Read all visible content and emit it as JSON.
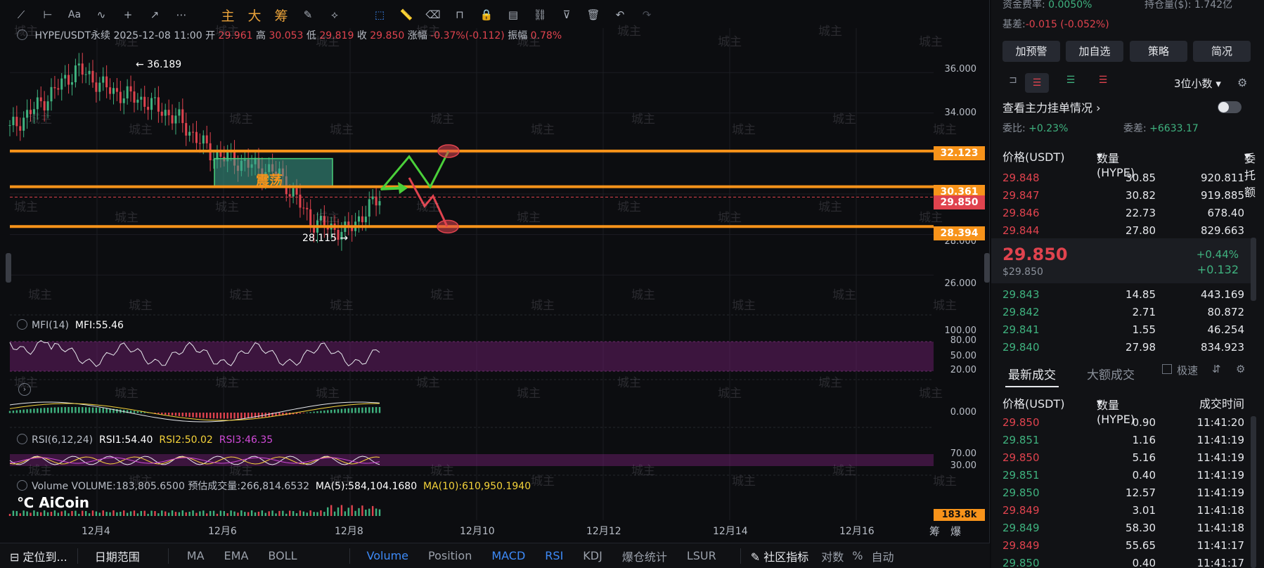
{
  "toolbar": {
    "icons": [
      "trend-line-icon",
      "horizontal-line-icon",
      "text-icon",
      "pen-icon",
      "crosshair-icon",
      "ray-icon",
      "more-icon"
    ],
    "zh_buttons": [
      "主",
      "大",
      "筹"
    ]
  },
  "info_bar": {
    "symbol": "HYPE/USDT永续",
    "datetime": "2025-12-08 11:00",
    "open_label": "开",
    "open": "29.961",
    "high_label": "高",
    "high": "30.053",
    "low_label": "低",
    "low": "29.819",
    "close_label": "收",
    "close": "29.850",
    "change_label": "涨幅",
    "change": "-0.37%(-0.112)",
    "amp_label": "振幅",
    "amp": "0.78%"
  },
  "chart_data": [
    {
      "type": "line",
      "title": "HYPE/USDT永续",
      "series": [
        {
          "name": "",
          "x": [
            "12月4",
            "12月4",
            "12月4",
            "12月5",
            "12月5",
            "12月5",
            "12月6",
            "12月6",
            "12月7",
            "12月7",
            "12月8",
            "12月8"
          ],
          "values": [
            33.2,
            34.6,
            36.19,
            35.1,
            34.6,
            33.7,
            32.0,
            31.5,
            31.0,
            28.6,
            28.12,
            29.85
          ]
        }
      ],
      "horizontal_lines": [
        32.123,
        30.361,
        28.394
      ],
      "high_label": "36.189",
      "low_label": "28.115",
      "box_label": "震荡",
      "ylim": [
        25.0,
        37.5
      ],
      "ytick_labels": [
        "36.000",
        "34.000",
        "32.000",
        "30.000",
        "28.000",
        "26.000"
      ],
      "xtick_labels": [
        "12月4",
        "12月6",
        "12月8",
        "12月10",
        "12月12",
        "12月14",
        "12月16"
      ]
    }
  ],
  "price_tags": {
    "upper": "32.123",
    "mid": "30.361",
    "current": "29.850",
    "lower": "28.394",
    "volume": "183.8k"
  },
  "annotations": {
    "high": "← 36.189",
    "low": "28.115 →",
    "box": "震荡"
  },
  "mfi": {
    "label": "MFI(14)",
    "value": "MFI:55.46",
    "ticks": [
      "100.00",
      "80.00",
      "50.00",
      "20.00"
    ]
  },
  "macd": {
    "ticks": [
      "0.000"
    ]
  },
  "rsi": {
    "label": "RSI(6,12,24)",
    "rsi1": "RSI1:54.40",
    "rsi2": "RSI2:50.02",
    "rsi3": "RSI3:46.35",
    "ticks": [
      "70.00",
      "30.00"
    ]
  },
  "volume": {
    "label": "Volume",
    "value": "VOLUME:183,805.6500",
    "est": "预估成交量:266,814.6532",
    "ma5": "MA(5):584,104.1680",
    "ma10": "MA(10):610,950.1940"
  },
  "logo": "AiCoin",
  "watermark": "城主",
  "xaxis_right": [
    "筹",
    "爆"
  ],
  "bottom_bar": {
    "locate": "定位到...",
    "range": "日期范围",
    "items": [
      "MA",
      "EMA",
      "BOLL",
      "Volume",
      "Position",
      "MACD",
      "RSI",
      "KDJ",
      "爆仓统计",
      "LSUR"
    ],
    "community": "社区指标",
    "log": "对数",
    "pct": "%",
    "auto": "自动"
  },
  "right_panel": {
    "funding_label": "资金费率:",
    "funding": "0.0050%",
    "oi_label": "持仓量($):",
    "oi": "1.742亿",
    "basis_label": "基差:",
    "basis": "-0.015 (-0.052%)",
    "buttons": [
      "加预警",
      "加自选",
      "策略",
      "简况"
    ],
    "decimals": "3位小数",
    "depth_title": "查看主力挂单情况",
    "ratio_label": "委比:",
    "ratio": "+0.23%",
    "diff_label": "委差:",
    "diff": "+6633.17",
    "ob_headers": [
      "价格(USDT)",
      "数量 (HYPE)",
      "委托额"
    ],
    "asks": [
      [
        "29.848",
        "30.85",
        "920.811"
      ],
      [
        "29.847",
        "30.82",
        "919.885"
      ],
      [
        "29.846",
        "22.73",
        "678.40"
      ],
      [
        "29.844",
        "27.80",
        "829.663"
      ]
    ],
    "last_price": "29.850",
    "last_usd": "$29.850",
    "last_pct": "+0.44%",
    "last_chg": "+0.132",
    "bids": [
      [
        "29.843",
        "14.85",
        "443.169"
      ],
      [
        "29.842",
        "2.71",
        "80.872"
      ],
      [
        "29.841",
        "1.55",
        "46.254"
      ],
      [
        "29.840",
        "27.98",
        "834.923"
      ]
    ],
    "trade_tabs": [
      "最新成交",
      "大额成交"
    ],
    "fast_label": "极速",
    "trade_headers": [
      "价格(USDT)",
      "数量(HYPE)",
      "成交时间"
    ],
    "trades": [
      [
        "29.850",
        "0.90",
        "11:41:20",
        "red"
      ],
      [
        "29.851",
        "1.16",
        "11:41:19",
        "green"
      ],
      [
        "29.850",
        "5.16",
        "11:41:19",
        "red"
      ],
      [
        "29.851",
        "0.40",
        "11:41:19",
        "green"
      ],
      [
        "29.850",
        "12.57",
        "11:41:19",
        "green"
      ],
      [
        "29.849",
        "3.01",
        "11:41:18",
        "red"
      ],
      [
        "29.849",
        "58.30",
        "11:41:18",
        "green"
      ],
      [
        "29.849",
        "55.65",
        "11:41:17",
        "red"
      ],
      [
        "29.850",
        "0.40",
        "11:41:17",
        "green"
      ]
    ]
  },
  "colors": {
    "up": "#3fb27f",
    "down": "#e0434e",
    "accent": "#f7931a",
    "blue": "#3d8af7"
  }
}
